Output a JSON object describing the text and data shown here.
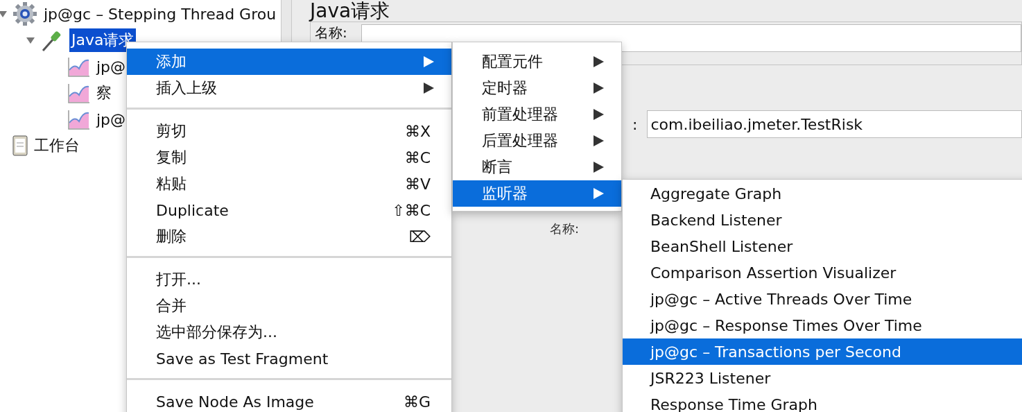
{
  "tree": [
    {
      "label": "jp@gc – Stepping Thread Grou",
      "kind": "thread-group",
      "expanded": true,
      "selected": false,
      "children": [
        {
          "label": "Java请求",
          "kind": "sampler",
          "expanded": true,
          "selected": true,
          "children": [
            {
              "label": "jp@",
              "kind": "graph",
              "selected": false
            },
            {
              "label": "察",
              "kind": "graph",
              "selected": false
            },
            {
              "label": "jp@",
              "kind": "graph",
              "selected": false
            }
          ]
        }
      ]
    },
    {
      "label": "工作台",
      "kind": "workbench",
      "selected": false
    }
  ],
  "editor": {
    "title": "Java请求",
    "name_label": "名称:",
    "class_label": ":",
    "class_value": "com.ibeiliao.jmeter.TestRisk",
    "second_name_label": "名称:"
  },
  "context_menu": [
    {
      "kind": "item",
      "label": "添加",
      "submenu": true,
      "selected": true
    },
    {
      "kind": "item",
      "label": "插入上级",
      "submenu": true,
      "selected": false
    },
    {
      "kind": "separator"
    },
    {
      "kind": "item",
      "label": "剪切",
      "shortcut": "⌘X",
      "submenu": false,
      "selected": false
    },
    {
      "kind": "item",
      "label": "复制",
      "shortcut": "⌘C",
      "submenu": false,
      "selected": false
    },
    {
      "kind": "item",
      "label": "粘贴",
      "shortcut": "⌘V",
      "submenu": false,
      "selected": false
    },
    {
      "kind": "item",
      "label": "Duplicate",
      "shortcut": "⇧⌘C",
      "submenu": false,
      "selected": false
    },
    {
      "kind": "item",
      "label": "删除",
      "shortcut": "⌦",
      "submenu": false,
      "selected": false
    },
    {
      "kind": "separator"
    },
    {
      "kind": "item",
      "label": "打开...",
      "submenu": false,
      "selected": false
    },
    {
      "kind": "item",
      "label": "合并",
      "submenu": false,
      "selected": false
    },
    {
      "kind": "item",
      "label": "选中部分保存为...",
      "submenu": false,
      "selected": false
    },
    {
      "kind": "item",
      "label": "Save as Test Fragment",
      "submenu": false,
      "selected": false
    },
    {
      "kind": "separator"
    },
    {
      "kind": "item",
      "label": "Save Node As Image",
      "shortcut": "⌘G",
      "submenu": false,
      "selected": false
    }
  ],
  "add_submenu": [
    {
      "label": "配置元件",
      "submenu": true,
      "selected": false
    },
    {
      "label": "定时器",
      "submenu": true,
      "selected": false
    },
    {
      "label": "前置处理器",
      "submenu": true,
      "selected": false
    },
    {
      "label": "后置处理器",
      "submenu": true,
      "selected": false
    },
    {
      "label": "断言",
      "submenu": true,
      "selected": false
    },
    {
      "label": "监听器",
      "submenu": true,
      "selected": true
    }
  ],
  "listener_submenu": [
    {
      "label": "Aggregate Graph",
      "selected": false
    },
    {
      "label": "Backend Listener",
      "selected": false
    },
    {
      "label": "BeanShell Listener",
      "selected": false
    },
    {
      "label": "Comparison Assertion Visualizer",
      "selected": false
    },
    {
      "label": "jp@gc – Active Threads Over Time",
      "selected": false
    },
    {
      "label": "jp@gc – Response Times Over Time",
      "selected": false
    },
    {
      "label": "jp@gc – Transactions per Second",
      "selected": true
    },
    {
      "label": "JSR223 Listener",
      "selected": false
    },
    {
      "label": "Response Time Graph",
      "selected": false
    }
  ]
}
